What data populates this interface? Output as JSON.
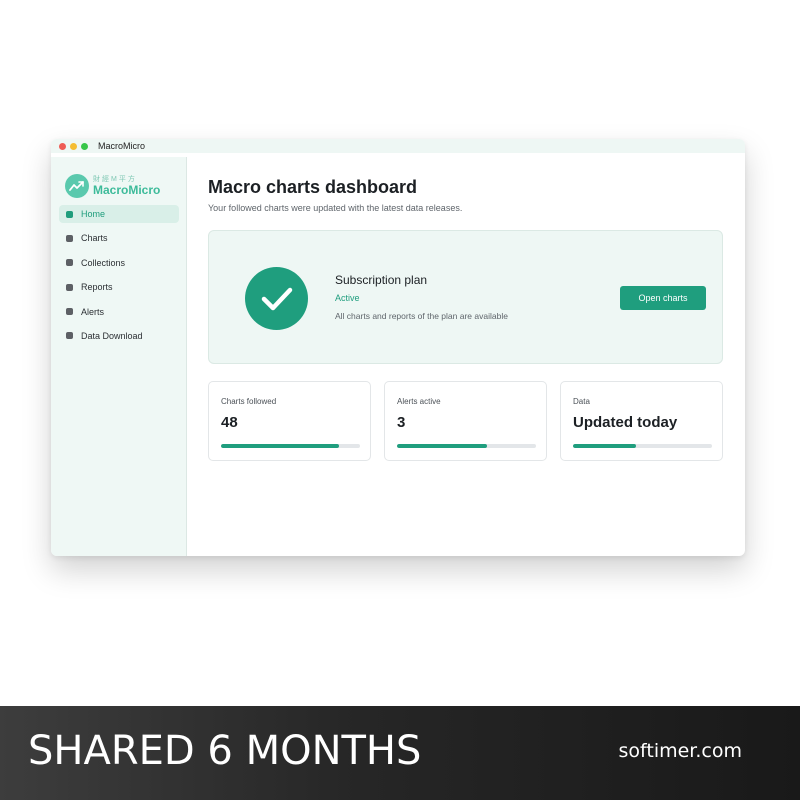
{
  "window": {
    "app_title": "MacroMicro"
  },
  "logo": {
    "chinese_text": "財經M平方",
    "brand_name": "MacroMicro"
  },
  "sidebar": {
    "items": [
      {
        "label": "Home",
        "active": true
      },
      {
        "label": "Charts"
      },
      {
        "label": "Collections"
      },
      {
        "label": "Reports"
      },
      {
        "label": "Alerts"
      },
      {
        "label": "Data Download"
      }
    ]
  },
  "main": {
    "title": "Macro charts dashboard",
    "subtitle": "Your followed charts were updated with the latest data releases."
  },
  "plan": {
    "title": "Subscription plan",
    "status": "Active",
    "description": "All charts and reports of the plan are available",
    "button_label": "Open charts"
  },
  "stats": [
    {
      "label": "Charts followed",
      "value": "48",
      "progress": 0.85
    },
    {
      "label": "Alerts active",
      "value": "3",
      "progress": 0.65
    },
    {
      "label": "Data",
      "value": "Updated today",
      "progress": 0.45
    }
  ],
  "banner": {
    "left_text": "SHARED 6 MONTHS",
    "right_text": "softimer.com"
  },
  "colors": {
    "accent": "#1f9e7e",
    "sidebar_bg": "#eff8f5",
    "card_bg": "#eef7f4"
  }
}
